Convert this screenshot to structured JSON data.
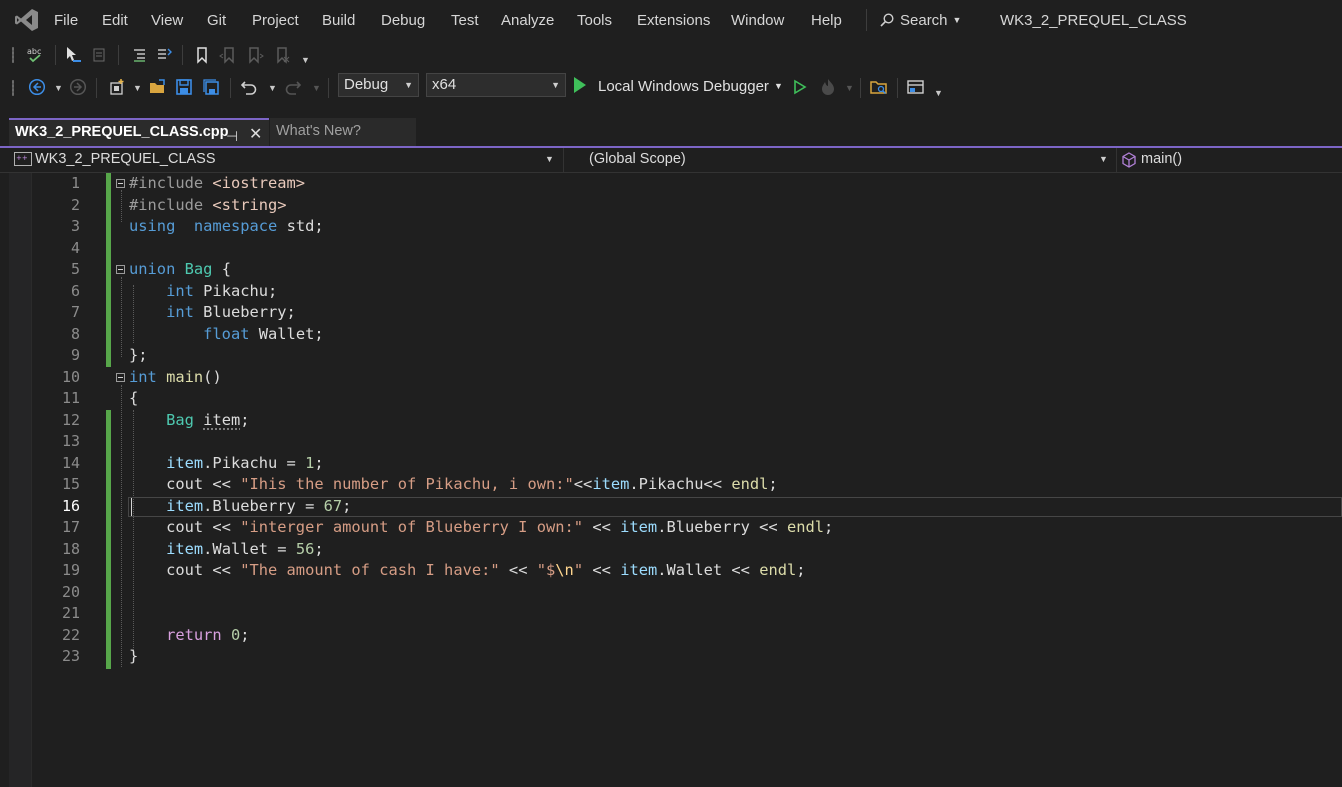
{
  "menu": {
    "items": [
      "File",
      "Edit",
      "View",
      "Git",
      "Project",
      "Build",
      "Debug",
      "Test",
      "Analyze",
      "Tools",
      "Extensions",
      "Window",
      "Help"
    ],
    "search_label": "Search",
    "window_title": "WK3_2_PREQUEL_CLASS"
  },
  "toolbar": {
    "configuration": "Debug",
    "platform": "x64",
    "run_label": "Local Windows Debugger"
  },
  "tabs": [
    {
      "label": "WK3_2_PREQUEL_CLASS.cpp",
      "active": true
    },
    {
      "label": "What's New?",
      "active": false
    }
  ],
  "navbar": {
    "project": "WK3_2_PREQUEL_CLASS",
    "scope": "(Global Scope)",
    "member": "main()"
  },
  "editor": {
    "current_line": 16,
    "line_numbers": [
      "1",
      "2",
      "3",
      "4",
      "5",
      "6",
      "7",
      "8",
      "9",
      "10",
      "11",
      "12",
      "13",
      "14",
      "15",
      "16",
      "17",
      "18",
      "19",
      "20",
      "21",
      "22",
      "23"
    ]
  },
  "colors": {
    "accent": "#7c65c6",
    "change_bar": "#57a64a",
    "keyword": "#569cd6",
    "type": "#4ec9b0",
    "string": "#d69d85",
    "number": "#b5cea8",
    "control_keyword": "#d8a0df"
  },
  "icons": [
    "visual-studio-logo",
    "search-icon",
    "spell-check-icon",
    "comment-icon",
    "bookmark-icon",
    "back-icon",
    "forward-icon",
    "new-project-icon",
    "open-folder-icon",
    "save-icon",
    "save-all-icon",
    "undo-icon",
    "redo-icon",
    "play-icon",
    "start-without-debug-icon",
    "hot-reload-icon",
    "solution-explorer-icon",
    "window-layout-icon",
    "pin-icon",
    "close-icon",
    "cube-icon"
  ]
}
